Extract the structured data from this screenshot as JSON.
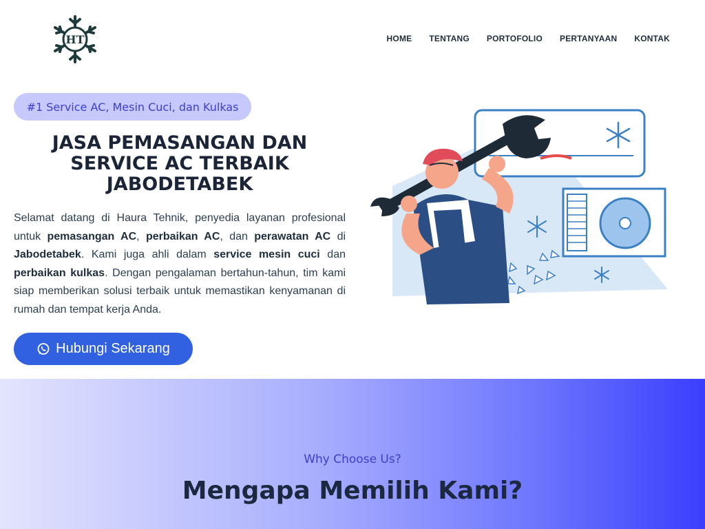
{
  "brand": {
    "logo_letters": "HT"
  },
  "nav": {
    "items": [
      {
        "label": "HOME"
      },
      {
        "label": "TENTANG"
      },
      {
        "label": "PORTOFOLIO"
      },
      {
        "label": "PERTANYAAN"
      },
      {
        "label": "KONTAK"
      }
    ]
  },
  "hero": {
    "badge": "#1 Service AC, Mesin Cuci, dan Kulkas",
    "title": "JASA PEMASANGAN DAN SERVICE AC TERBAIK JABODETABEK",
    "text": {
      "t1": "Selamat datang di Haura Tehnik, penyedia layanan profesional untuk ",
      "b1": "pemasangan AC",
      "t2": ", ",
      "b2": "perbaikan AC",
      "t3": ", dan ",
      "b3": "perawatan AC",
      "t4": " di ",
      "b4": "Jabodetabek",
      "t5": ". Kami juga ahli dalam ",
      "b5": "service mesin cuci",
      "t6": " dan ",
      "b6": "perbaikan kulkas",
      "t7": ". Dengan pengalaman bertahun-tahun, tim kami siap memberikan solusi terbaik untuk memastikan kenyamanan di rumah dan tempat kerja Anda."
    },
    "cta_label": "Hubungi Sekarang"
  },
  "why": {
    "kicker": "Why Choose Us?",
    "title": "Mengapa Memilih Kami?"
  },
  "colors": {
    "badge_bg": "#c7c9fd",
    "badge_text": "#3b3ed0",
    "cta_bg": "#3161e0",
    "section_gradient_end": "#3a3ffd"
  },
  "icons": [
    "snowflake-logo-icon",
    "whatsapp-icon",
    "technician-illustration"
  ]
}
